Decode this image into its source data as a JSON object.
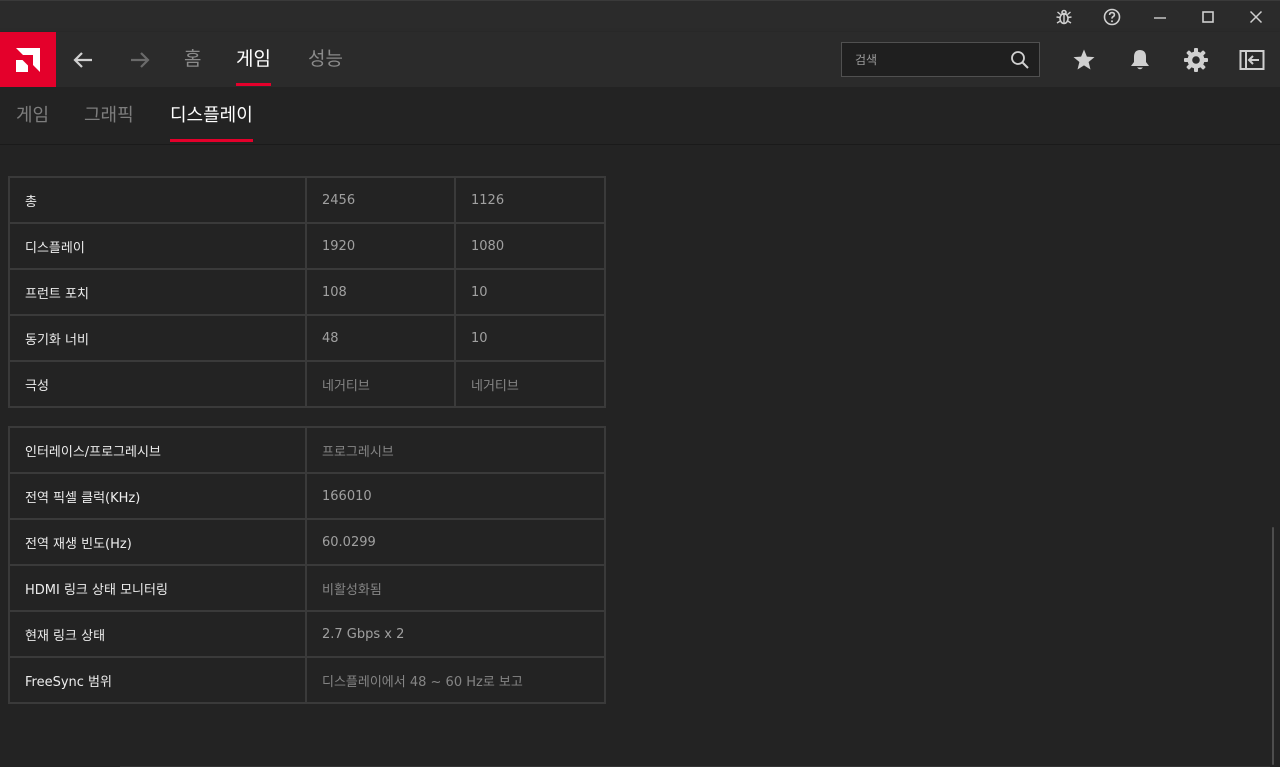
{
  "brand": {
    "logo_icon": "amd-logo-icon",
    "accent": "#e4002b"
  },
  "titlebar": {
    "buttons": [
      {
        "name": "bug-report-button",
        "icon": "bug-icon"
      },
      {
        "name": "help-button",
        "icon": "help-icon"
      },
      {
        "name": "minimize-button",
        "icon": "minimize-icon"
      },
      {
        "name": "maximize-button",
        "icon": "maximize-icon"
      },
      {
        "name": "close-button",
        "icon": "close-icon"
      }
    ]
  },
  "nav": {
    "tabs": [
      {
        "label": "홈",
        "active": false
      },
      {
        "label": "게임",
        "active": true
      },
      {
        "label": "성능",
        "active": false
      }
    ],
    "search": {
      "placeholder": "검색",
      "value": ""
    },
    "icons": [
      "back-arrow-icon",
      "forward-arrow-icon",
      "search-icon",
      "star-icon",
      "bell-icon",
      "gear-icon",
      "sidebar-toggle-icon"
    ]
  },
  "subnav": {
    "tabs": [
      {
        "label": "게임",
        "active": false
      },
      {
        "label": "그래픽",
        "active": false
      },
      {
        "label": "디스플레이",
        "active": true
      }
    ]
  },
  "timing_table": {
    "rows": [
      {
        "label": "총",
        "h": "2456",
        "v": "1126"
      },
      {
        "label": "디스플레이",
        "h": "1920",
        "v": "1080"
      },
      {
        "label": "프런트 포치",
        "h": "108",
        "v": "10"
      },
      {
        "label": "동기화 너비",
        "h": "48",
        "v": "10"
      },
      {
        "label": "극성",
        "h": "네거티브",
        "v": "네거티브"
      }
    ]
  },
  "info_table": {
    "rows": [
      {
        "label": "인터레이스/프로그레시브",
        "value": "프로그레시브"
      },
      {
        "label": "전역 픽셀 클럭(KHz)",
        "value": "166010"
      },
      {
        "label": "전역 재생 빈도(Hz)",
        "value": "60.0299"
      },
      {
        "label": "HDMI 링크 상태 모니터링",
        "value": "비활성화됨"
      },
      {
        "label": "현재 링크 상태",
        "value": "2.7 Gbps x 2"
      },
      {
        "label": "FreeSync 범위",
        "value": "디스플레이에서 48 ~ 60 Hz로 보고"
      }
    ]
  }
}
